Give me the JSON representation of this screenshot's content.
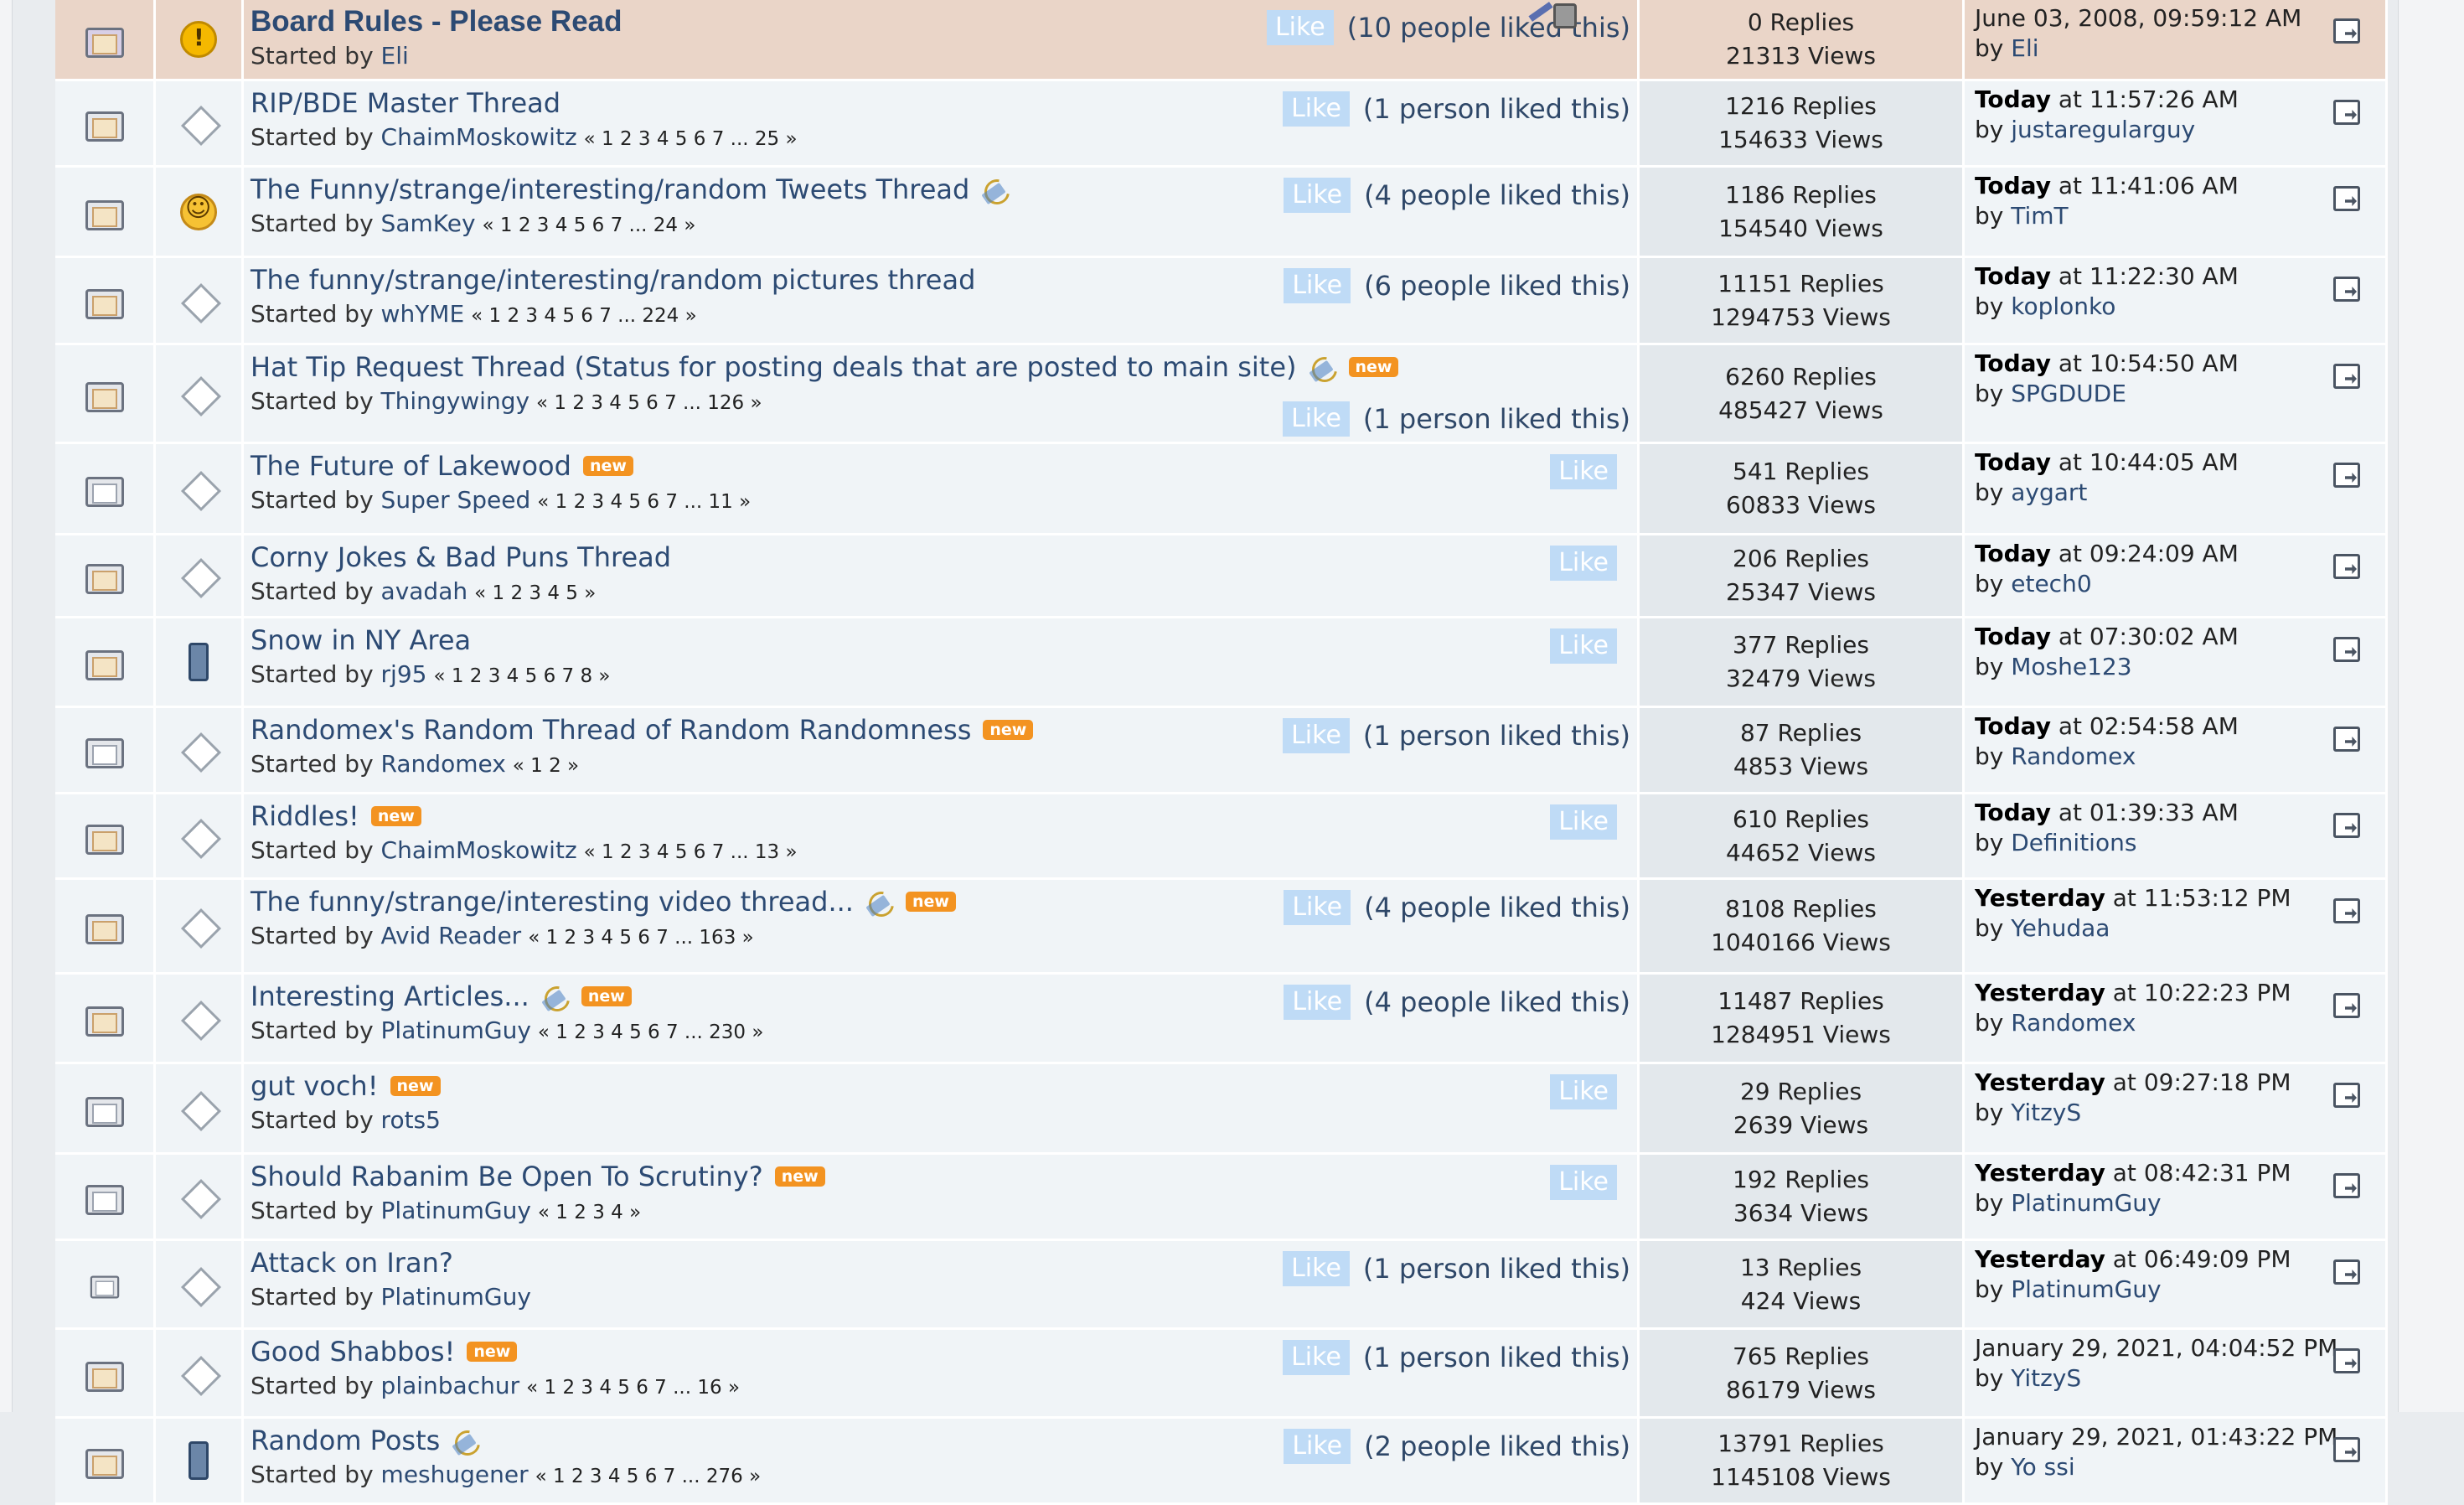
{
  "topics": [
    {
      "type": "sticky",
      "icon1": "sticky-locked-topic-icon",
      "icon2": "warning-icon",
      "title": "Board Rules - Please Read",
      "author": "Eli",
      "pages": "",
      "like": "Like",
      "liked": "(10 people liked this)",
      "like_pos": "top",
      "replies": "0 Replies",
      "views": "21313 Views",
      "last_date": "",
      "last_date_plain": "June 03, 2008, 09:59:12 AM",
      "last_by": "Eli",
      "clip": false,
      "new": false
    },
    {
      "icon1": "hot-topic-icon",
      "icon2": "diamond-icon",
      "title": "RIP/BDE Master Thread",
      "author": "ChaimMoskowitz",
      "pages": "« 1 2 3 4 5 6 7 ... 25 »",
      "like": "Like",
      "liked": "(1 person liked this)",
      "like_pos": "top",
      "replies": "1216 Replies",
      "views": "154633 Views",
      "last_date": "Today",
      "last_time": " at 11:57:26 AM",
      "last_by": "justaregularguy",
      "clip": false,
      "new": false
    },
    {
      "icon1": "hot-topic-icon",
      "icon2": "smile-icon",
      "title": "The Funny/strange/interesting/random Tweets Thread",
      "author": "SamKey",
      "pages": "« 1 2 3 4 5 6 7 ... 24 »",
      "like": "Like",
      "liked": "(4 people liked this)",
      "like_pos": "top",
      "replies": "1186 Replies",
      "views": "154540 Views",
      "last_date": "Today",
      "last_time": " at 11:41:06 AM",
      "last_by": "TimT",
      "clip": true,
      "new": false
    },
    {
      "icon1": "hot-topic-icon",
      "icon2": "diamond-icon",
      "title": "The funny/strange/interesting/random pictures thread",
      "author": "whYME",
      "pages": "« 1 2 3 4 5 6 7 ... 224 »",
      "like": "Like",
      "liked": "(6 people liked this)",
      "like_pos": "top",
      "replies": "11151 Replies",
      "views": "1294753 Views",
      "last_date": "Today",
      "last_time": " at 11:22:30 AM",
      "last_by": "koplonko",
      "clip": false,
      "new": false
    },
    {
      "icon1": "hot-topic-icon",
      "icon2": "diamond-icon",
      "title": "Hat Tip Request Thread (Status for posting deals that are posted to main site)",
      "author": "Thingywingy",
      "pages": "« 1 2 3 4 5 6 7 ... 126 »",
      "like": "Like",
      "liked": "(1 person liked this)",
      "like_pos": "bottom",
      "replies": "6260 Replies",
      "views": "485427 Views",
      "last_date": "Today",
      "last_time": " at 10:54:50 AM",
      "last_by": "SPGDUDE",
      "clip": true,
      "new": true
    },
    {
      "icon1": "topic-icon",
      "icon2": "diamond-icon",
      "title": "The Future of Lakewood",
      "author": "Super Speed",
      "pages": "« 1 2 3 4 5 6 7 ... 11 »",
      "like": "Like",
      "liked": "",
      "like_pos": "top",
      "replies": "541 Replies",
      "views": "60833 Views",
      "last_date": "Today",
      "last_time": " at 10:44:05 AM",
      "last_by": "aygart",
      "clip": false,
      "new": true
    },
    {
      "icon1": "hot-topic-icon",
      "icon2": "diamond-icon",
      "title": "Corny Jokes & Bad Puns Thread",
      "author": "avadah",
      "pages": "« 1 2 3 4 5 »",
      "like": "Like",
      "liked": "",
      "like_pos": "top",
      "replies": "206 Replies",
      "views": "25347 Views",
      "last_date": "Today",
      "last_time": " at 09:24:09 AM",
      "last_by": "etech0",
      "clip": false,
      "new": false
    },
    {
      "icon1": "hot-topic-icon",
      "icon2": "phone-icon",
      "title": "Snow in NY Area",
      "author": "rj95",
      "pages": "« 1 2 3 4 5 6 7 8 »",
      "like": "Like",
      "liked": "",
      "like_pos": "top",
      "replies": "377 Replies",
      "views": "32479 Views",
      "last_date": "Today",
      "last_time": " at 07:30:02 AM",
      "last_by": "Moshe123",
      "clip": false,
      "new": false
    },
    {
      "icon1": "topic-icon",
      "icon2": "diamond-icon",
      "title": "Randomex's Random Thread of Random Randomness",
      "author": "Randomex",
      "pages": "« 1 2 »",
      "like": "Like",
      "liked": "(1 person liked this)",
      "like_pos": "top",
      "replies": "87 Replies",
      "views": "4853 Views",
      "last_date": "Today",
      "last_time": " at 02:54:58 AM",
      "last_by": "Randomex",
      "clip": false,
      "new": true
    },
    {
      "icon1": "hot-topic-icon",
      "icon2": "diamond-icon",
      "title": "Riddles!",
      "author": "ChaimMoskowitz",
      "pages": "« 1 2 3 4 5 6 7 ... 13 »",
      "like": "Like",
      "liked": "",
      "like_pos": "top",
      "replies": "610 Replies",
      "views": "44652 Views",
      "last_date": "Today",
      "last_time": " at 01:39:33 AM",
      "last_by": "Definitions",
      "clip": false,
      "new": true
    },
    {
      "icon1": "hot-topic-icon",
      "icon2": "diamond-icon",
      "title": "The funny/strange/interesting video thread...",
      "author": "Avid Reader",
      "pages": "« 1 2 3 4 5 6 7 ... 163 »",
      "like": "Like",
      "liked": "(4 people liked this)",
      "like_pos": "top",
      "replies": "8108 Replies",
      "views": "1040166 Views",
      "last_date": "Yesterday",
      "last_time": " at 11:53:12 PM",
      "last_by": "Yehudaa",
      "clip": true,
      "new": true
    },
    {
      "icon1": "hot-topic-icon",
      "icon2": "diamond-icon",
      "title": "Interesting Articles...",
      "author": "PlatinumGuy",
      "pages": "« 1 2 3 4 5 6 7 ... 230 »",
      "like": "Like",
      "liked": "(4 people liked this)",
      "like_pos": "top",
      "replies": "11487 Replies",
      "views": "1284951 Views",
      "last_date": "Yesterday",
      "last_time": " at 10:22:23 PM",
      "last_by": "Randomex",
      "clip": true,
      "new": true
    },
    {
      "icon1": "topic-icon",
      "icon2": "diamond-icon",
      "title": "gut voch!",
      "author": "rots5",
      "pages": "",
      "like": "Like",
      "liked": "",
      "like_pos": "top",
      "replies": "29 Replies",
      "views": "2639 Views",
      "last_date": "Yesterday",
      "last_time": " at 09:27:18 PM",
      "last_by": "YitzyS",
      "clip": false,
      "new": true
    },
    {
      "icon1": "topic-icon",
      "icon2": "diamond-icon",
      "title": "Should Rabanim Be Open To Scrutiny?",
      "author": "PlatinumGuy",
      "pages": "« 1 2 3 4 »",
      "like": "Like",
      "liked": "",
      "like_pos": "top",
      "replies": "192 Replies",
      "views": "3634 Views",
      "last_date": "Yesterday",
      "last_time": " at 08:42:31 PM",
      "last_by": "PlatinumGuy",
      "clip": false,
      "new": true
    },
    {
      "icon1": "small-topic-icon",
      "icon2": "diamond-icon",
      "title": "Attack on Iran?",
      "author": "PlatinumGuy",
      "pages": "",
      "like": "Like",
      "liked": "(1 person liked this)",
      "like_pos": "top",
      "replies": "13 Replies",
      "views": "424 Views",
      "last_date": "Yesterday",
      "last_time": " at 06:49:09 PM",
      "last_by": "PlatinumGuy",
      "clip": false,
      "new": false
    },
    {
      "icon1": "hot-topic-icon",
      "icon2": "diamond-icon",
      "title": "Good Shabbos!",
      "author": "plainbachur",
      "pages": "« 1 2 3 4 5 6 7 ... 16 »",
      "like": "Like",
      "liked": "(1 person liked this)",
      "like_pos": "top",
      "replies": "765 Replies",
      "views": "86179 Views",
      "last_date": "",
      "last_date_plain": "January 29, 2021, 04:04:52 PM",
      "last_by": "YitzyS",
      "clip": false,
      "new": true
    },
    {
      "icon1": "hot-topic-icon",
      "icon2": "phone-icon",
      "title": "Random Posts",
      "author": "meshugener",
      "pages": "« 1 2 3 4 5 6 7 ... 276 »",
      "like": "Like",
      "liked": "(2 people liked this)",
      "like_pos": "top",
      "replies": "13791 Replies",
      "views": "1145108 Views",
      "last_date": "",
      "last_date_plain": "January 29, 2021, 01:43:22 PM",
      "last_by": "Yo ssi",
      "clip": true,
      "new": false
    }
  ],
  "labels": {
    "started_by": "Started by ",
    "by": "by ",
    "new": "new"
  },
  "colors": {
    "sticky_bg": "#ead5c8",
    "row_bg": "#f0f4f7",
    "stats_bg": "#e3e8ec",
    "link": "#2c4a73",
    "new_badge": "#f39321",
    "like_btn": "#bfdbf6"
  }
}
